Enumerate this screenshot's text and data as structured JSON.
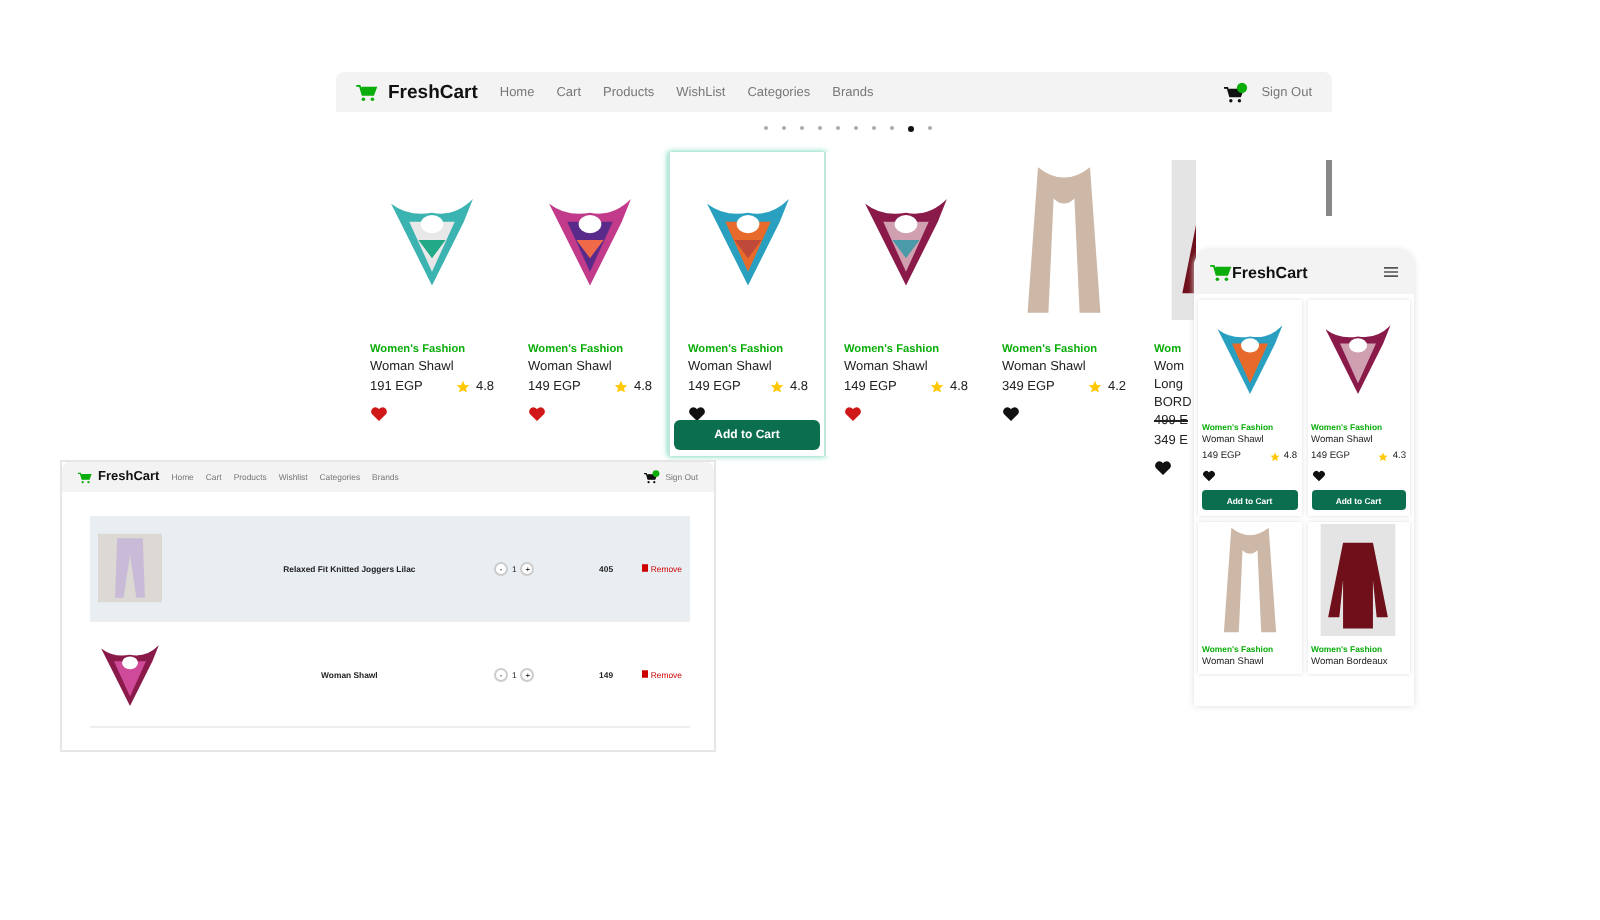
{
  "desktop": {
    "nav": {
      "logo": "FreshCart",
      "links": [
        "Home",
        "Cart",
        "Products",
        "WishList",
        "Categories",
        "Brands"
      ],
      "sign_out": "Sign Out"
    },
    "dots": [
      {
        "selected": false
      },
      {
        "selected": false
      },
      {
        "selected": false
      },
      {
        "selected": false
      },
      {
        "selected": false
      },
      {
        "selected": false
      },
      {
        "selected": false
      },
      {
        "selected": false
      },
      {
        "selected": true
      },
      {
        "selected": false
      }
    ],
    "add_to_cart": "Add to Cart",
    "products": [
      {
        "kind": "scarf",
        "category": "Women's Fashion",
        "name_lines": [
          "Woman Shawl"
        ],
        "price": "191 EGP",
        "rating": "4.8",
        "wishlisted": true,
        "hovered": false
      },
      {
        "kind": "scarf",
        "category": "Women's Fashion",
        "name_lines": [
          "Woman Shawl"
        ],
        "price": "149 EGP",
        "rating": "4.8",
        "wishlisted": true,
        "hovered": false
      },
      {
        "kind": "scarf",
        "category": "Women's Fashion",
        "name_lines": [
          "Woman Shawl"
        ],
        "price": "149 EGP",
        "rating": "4.8",
        "wishlisted": false,
        "hovered": true
      },
      {
        "kind": "scarf",
        "category": "Women's Fashion",
        "name_lines": [
          "Woman Shawl"
        ],
        "price": "149 EGP",
        "rating": "4.8",
        "wishlisted": true,
        "hovered": false
      },
      {
        "kind": "longscarf",
        "category": "Women's Fashion",
        "name_lines": [
          "Woman Shawl"
        ],
        "price": "349 EGP",
        "rating": "4.2",
        "wishlisted": false,
        "hovered": false
      },
      {
        "kind": "shirt",
        "category": "Wom",
        "name_lines": [
          "Wom",
          "Long",
          "BORD"
        ],
        "old_price": "499 E",
        "price": "349 E",
        "wishlisted": false,
        "hovered": false
      }
    ]
  },
  "cart": {
    "nav": {
      "logo": "FreshCart",
      "links": [
        "Home",
        "Cart",
        "Products",
        "Wishlist",
        "Categories",
        "Brands"
      ],
      "sign_out": "Sign Out"
    },
    "items": [
      {
        "kind": "joggers",
        "name": "Relaxed Fit Knitted Joggers Lilac",
        "minus": "-",
        "qty": "1",
        "plus": "+",
        "price": "405",
        "remove": "Remove",
        "highlighted": true
      },
      {
        "kind": "scarf",
        "name": "Woman Shawl",
        "minus": "-",
        "qty": "1",
        "plus": "+",
        "price": "149",
        "remove": "Remove",
        "highlighted": false
      }
    ]
  },
  "mobile": {
    "logo": "FreshCart",
    "products": [
      {
        "kind": "scarf",
        "category": "Women's Fashion",
        "name": "Woman Shawl",
        "price": "149 EGP",
        "rating": "4.8",
        "wishlisted": false,
        "add_to_cart": "Add to Cart"
      },
      {
        "kind": "scarf",
        "category": "Women's Fashion",
        "name": "Woman Shawl",
        "price": "149 EGP",
        "rating": "4.3",
        "wishlisted": false,
        "add_to_cart": "Add to Cart"
      },
      {
        "kind": "longscarf",
        "category": "Women's Fashion",
        "name": "Woman Shawl"
      },
      {
        "kind": "shirt",
        "category": "Women's Fashion",
        "name": "Woman Bordeaux"
      }
    ]
  }
}
